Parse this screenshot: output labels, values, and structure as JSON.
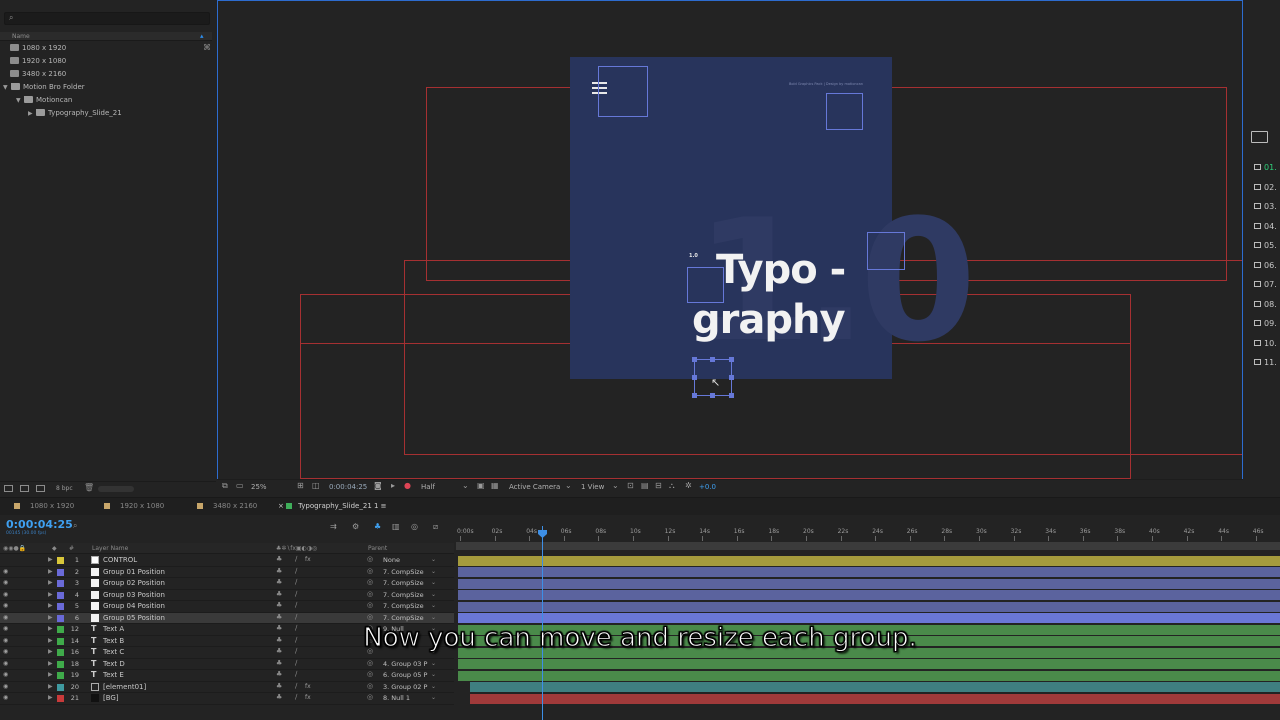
{
  "project": {
    "header_name": "Name",
    "items": [
      {
        "label": "1080 x 1920",
        "kind": "comp"
      },
      {
        "label": "1920 x 1080",
        "kind": "comp"
      },
      {
        "label": "3480 x 2160",
        "kind": "comp"
      },
      {
        "label": "Motion Bro Folder",
        "kind": "folder"
      },
      {
        "label": "Motioncan",
        "kind": "folder"
      },
      {
        "label": "Typography_Slide_21",
        "kind": "folder"
      }
    ],
    "bpc": "8 bpc"
  },
  "viewer": {
    "comp_title_line1": "Typo -",
    "comp_title_line2": "graphy",
    "big_number": "1.0",
    "small_label": "1.0",
    "credit": "Bold Graphics Pack | Design by motioncan",
    "zoom": "25%",
    "timecode": "0:00:04:25",
    "resolution": "Half",
    "camera": "Active Camera",
    "views": "1 View",
    "exposure": "+0.0"
  },
  "right_panel": {
    "items": [
      "01.",
      "02.",
      "03.",
      "04.",
      "05.",
      "06.",
      "07.",
      "08.",
      "09.",
      "10.",
      "11."
    ],
    "active_index": 0
  },
  "timeline": {
    "tabs": [
      {
        "label": "1080 x 1920",
        "color": "#c8a66a"
      },
      {
        "label": "1920 x 1080",
        "color": "#c8a66a"
      },
      {
        "label": "3480 x 2160",
        "color": "#c8a66a"
      },
      {
        "label": "Typography_Slide_21 1",
        "color": "#3fae5a",
        "active": true
      }
    ],
    "timecode": "0:00:04:25",
    "timecode_sub": "00145 (30.00 fps)",
    "header": {
      "label": "#",
      "layer_name": "Layer Name",
      "parent": "Parent"
    },
    "ruler": [
      "0:00s",
      "02s",
      "04s",
      "06s",
      "08s",
      "10s",
      "12s",
      "14s",
      "16s",
      "18s",
      "20s",
      "22s",
      "24s",
      "26s",
      "28s",
      "30s",
      "32s",
      "34s",
      "36s",
      "38s",
      "40s",
      "42s",
      "44s",
      "46s"
    ],
    "layers": [
      {
        "num": "1",
        "name": "CONTROL",
        "color": "#d8c63a",
        "icon": "null",
        "parent": "None",
        "bar": "#a59b3d"
      },
      {
        "num": "2",
        "name": "Group 01 Position",
        "color": "#6a6ad8",
        "icon": "solid",
        "parent": "7. CompSize",
        "bar": "#5b639e"
      },
      {
        "num": "3",
        "name": "Group 02 Position",
        "color": "#6a6ad8",
        "icon": "solid",
        "parent": "7. CompSize",
        "bar": "#5b639e"
      },
      {
        "num": "4",
        "name": "Group 03 Position",
        "color": "#6a6ad8",
        "icon": "solid",
        "parent": "7. CompSize",
        "bar": "#5b639e"
      },
      {
        "num": "5",
        "name": "Group 04 Position",
        "color": "#6a6ad8",
        "icon": "solid",
        "parent": "7. CompSize",
        "bar": "#5b639e"
      },
      {
        "num": "6",
        "name": "Group 05 Position",
        "color": "#6a6ad8",
        "icon": "solid",
        "parent": "7. CompSize",
        "bar": "#6a77d6",
        "selected": true
      },
      {
        "num": "12",
        "name": "Text A",
        "color": "#3faa4a",
        "icon": "text",
        "parent": "9. Null",
        "bar": "#4a8a4a"
      },
      {
        "num": "14",
        "name": "Text B",
        "color": "#3faa4a",
        "icon": "text",
        "parent": "",
        "bar": "#4a8a4a"
      },
      {
        "num": "16",
        "name": "Text C",
        "color": "#3faa4a",
        "icon": "text",
        "parent": "",
        "bar": "#4a8a4a"
      },
      {
        "num": "18",
        "name": "Text D",
        "color": "#3faa4a",
        "icon": "text",
        "parent": "4. Group 03 P",
        "bar": "#4a8a4a"
      },
      {
        "num": "19",
        "name": "Text E",
        "color": "#3faa4a",
        "icon": "text",
        "parent": "6. Group 05 P",
        "bar": "#4a8a4a"
      },
      {
        "num": "20",
        "name": "[element01]",
        "color": "#3f9aa0",
        "icon": "comp",
        "parent": "3. Group 02 P",
        "bar": "#3f7f80"
      },
      {
        "num": "21",
        "name": "[BG]",
        "color": "#c83a3a",
        "icon": "solid",
        "parent": "8. Null 1",
        "bar": "#a03a3a"
      }
    ]
  },
  "subtitle": "Now you can move and resize each group.",
  "colors": {
    "accent": "#2d8ceb",
    "comp_bg": "#28345c",
    "guide_red": "#a53032",
    "selection_blue": "#6678d8"
  }
}
